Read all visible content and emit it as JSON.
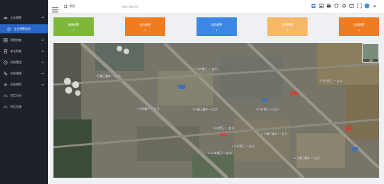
{
  "sidebar": {
    "items": [
      {
        "label": "企业预警"
      },
      {
        "label": "企业预警首页"
      },
      {
        "label": "隐患排查"
      },
      {
        "label": "安全检查"
      },
      {
        "label": "风险管控"
      },
      {
        "label": "应急救援"
      },
      {
        "label": "应急物资"
      },
      {
        "label": "特定企业"
      },
      {
        "label": "特定设施"
      }
    ]
  },
  "topbar": {
    "breadcrumb": "首页",
    "search_placeholder": "请输入搜索内容"
  },
  "cards": [
    {
      "title": "隐患报警",
      "value": "1",
      "color": "#7db83b"
    },
    {
      "title": "违法报警",
      "value": "1",
      "color": "#f07c22"
    },
    {
      "title": "风险报警",
      "value": "0",
      "color": "#3b87e6"
    },
    {
      "title": "异常报警",
      "value": "0",
      "color": "#f6b867"
    },
    {
      "title": "设备报警",
      "value": "0",
      "color": "#f07c22"
    }
  ],
  "map": {
    "labels": [
      "1号罐区罐体****监测",
      "2号装置区****监测",
      "3号装置区****监测",
      "4号储罐区****监测",
      "5号罐区罐体****监测",
      "6号装置区****监测",
      "7号装置区****监测",
      "8号罐区罐体****监测",
      "9号装置区****监测",
      "10号装置区****监测",
      "11号罐区罐体****监测"
    ],
    "minimap_caption": "卫星"
  }
}
